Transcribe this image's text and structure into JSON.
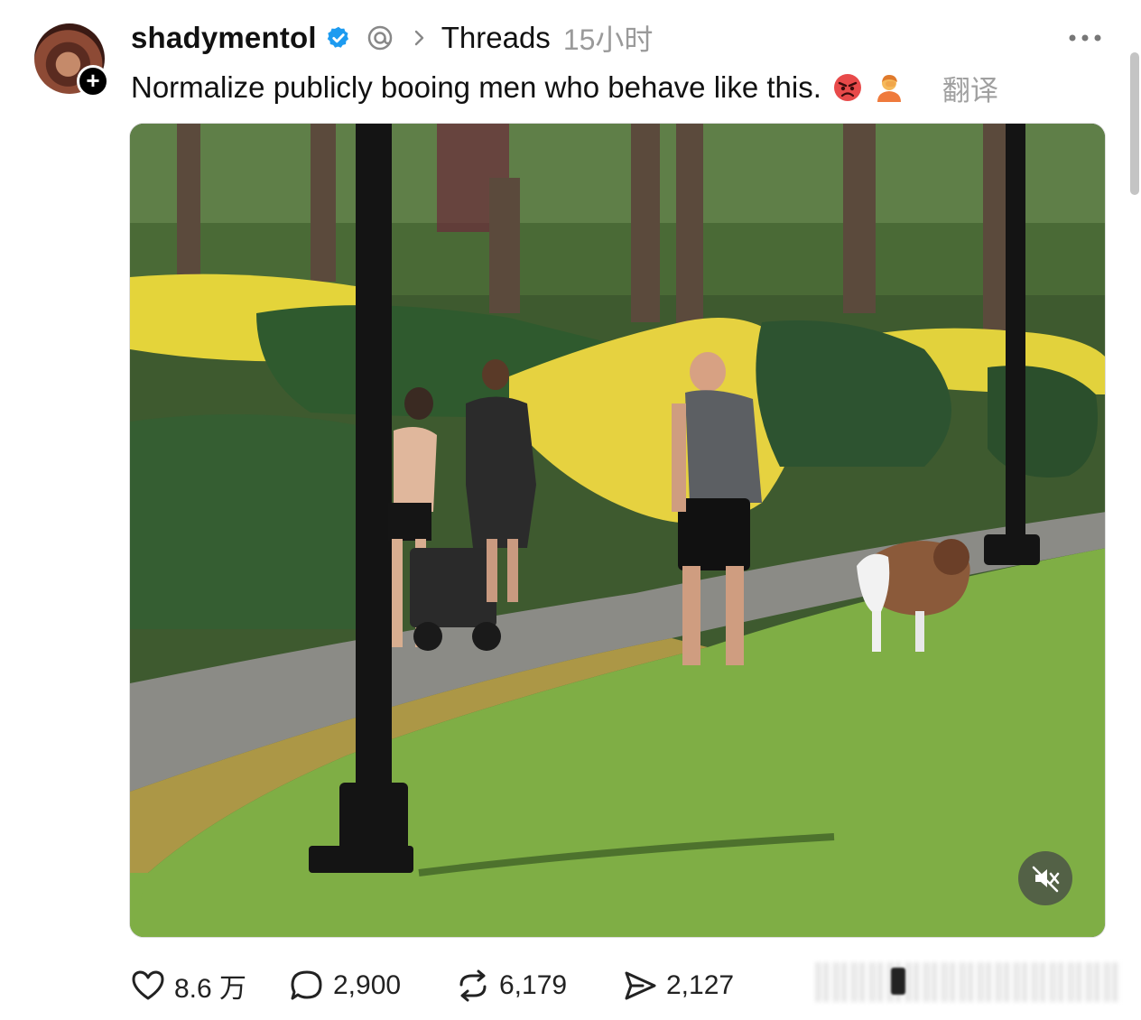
{
  "post": {
    "username": "shadymentol",
    "source": "Threads",
    "time": "15小时",
    "text": "Normalize publicly booing men who behave like this.",
    "translate_label": "翻译",
    "emojis": [
      "angry-face-emoji",
      "person-facepalming-emoji"
    ]
  },
  "media": {
    "type": "video",
    "muted": true,
    "description_icon": "mute-icon"
  },
  "actions": {
    "likes": "8.6 万",
    "replies": "2,900",
    "reposts": "6,179",
    "shares": "2,127"
  },
  "icons": {
    "verified": "verified-badge-icon",
    "threads": "threads-logo-icon",
    "chevron": "chevron-right-icon",
    "more": "more-icon",
    "follow": "plus-icon",
    "like": "heart-icon",
    "reply": "comment-icon",
    "repost": "repost-icon",
    "share": "send-icon"
  },
  "colors": {
    "verified": "#1d9bf0",
    "text": "#111111",
    "muted_text": "#9a9a9a"
  }
}
